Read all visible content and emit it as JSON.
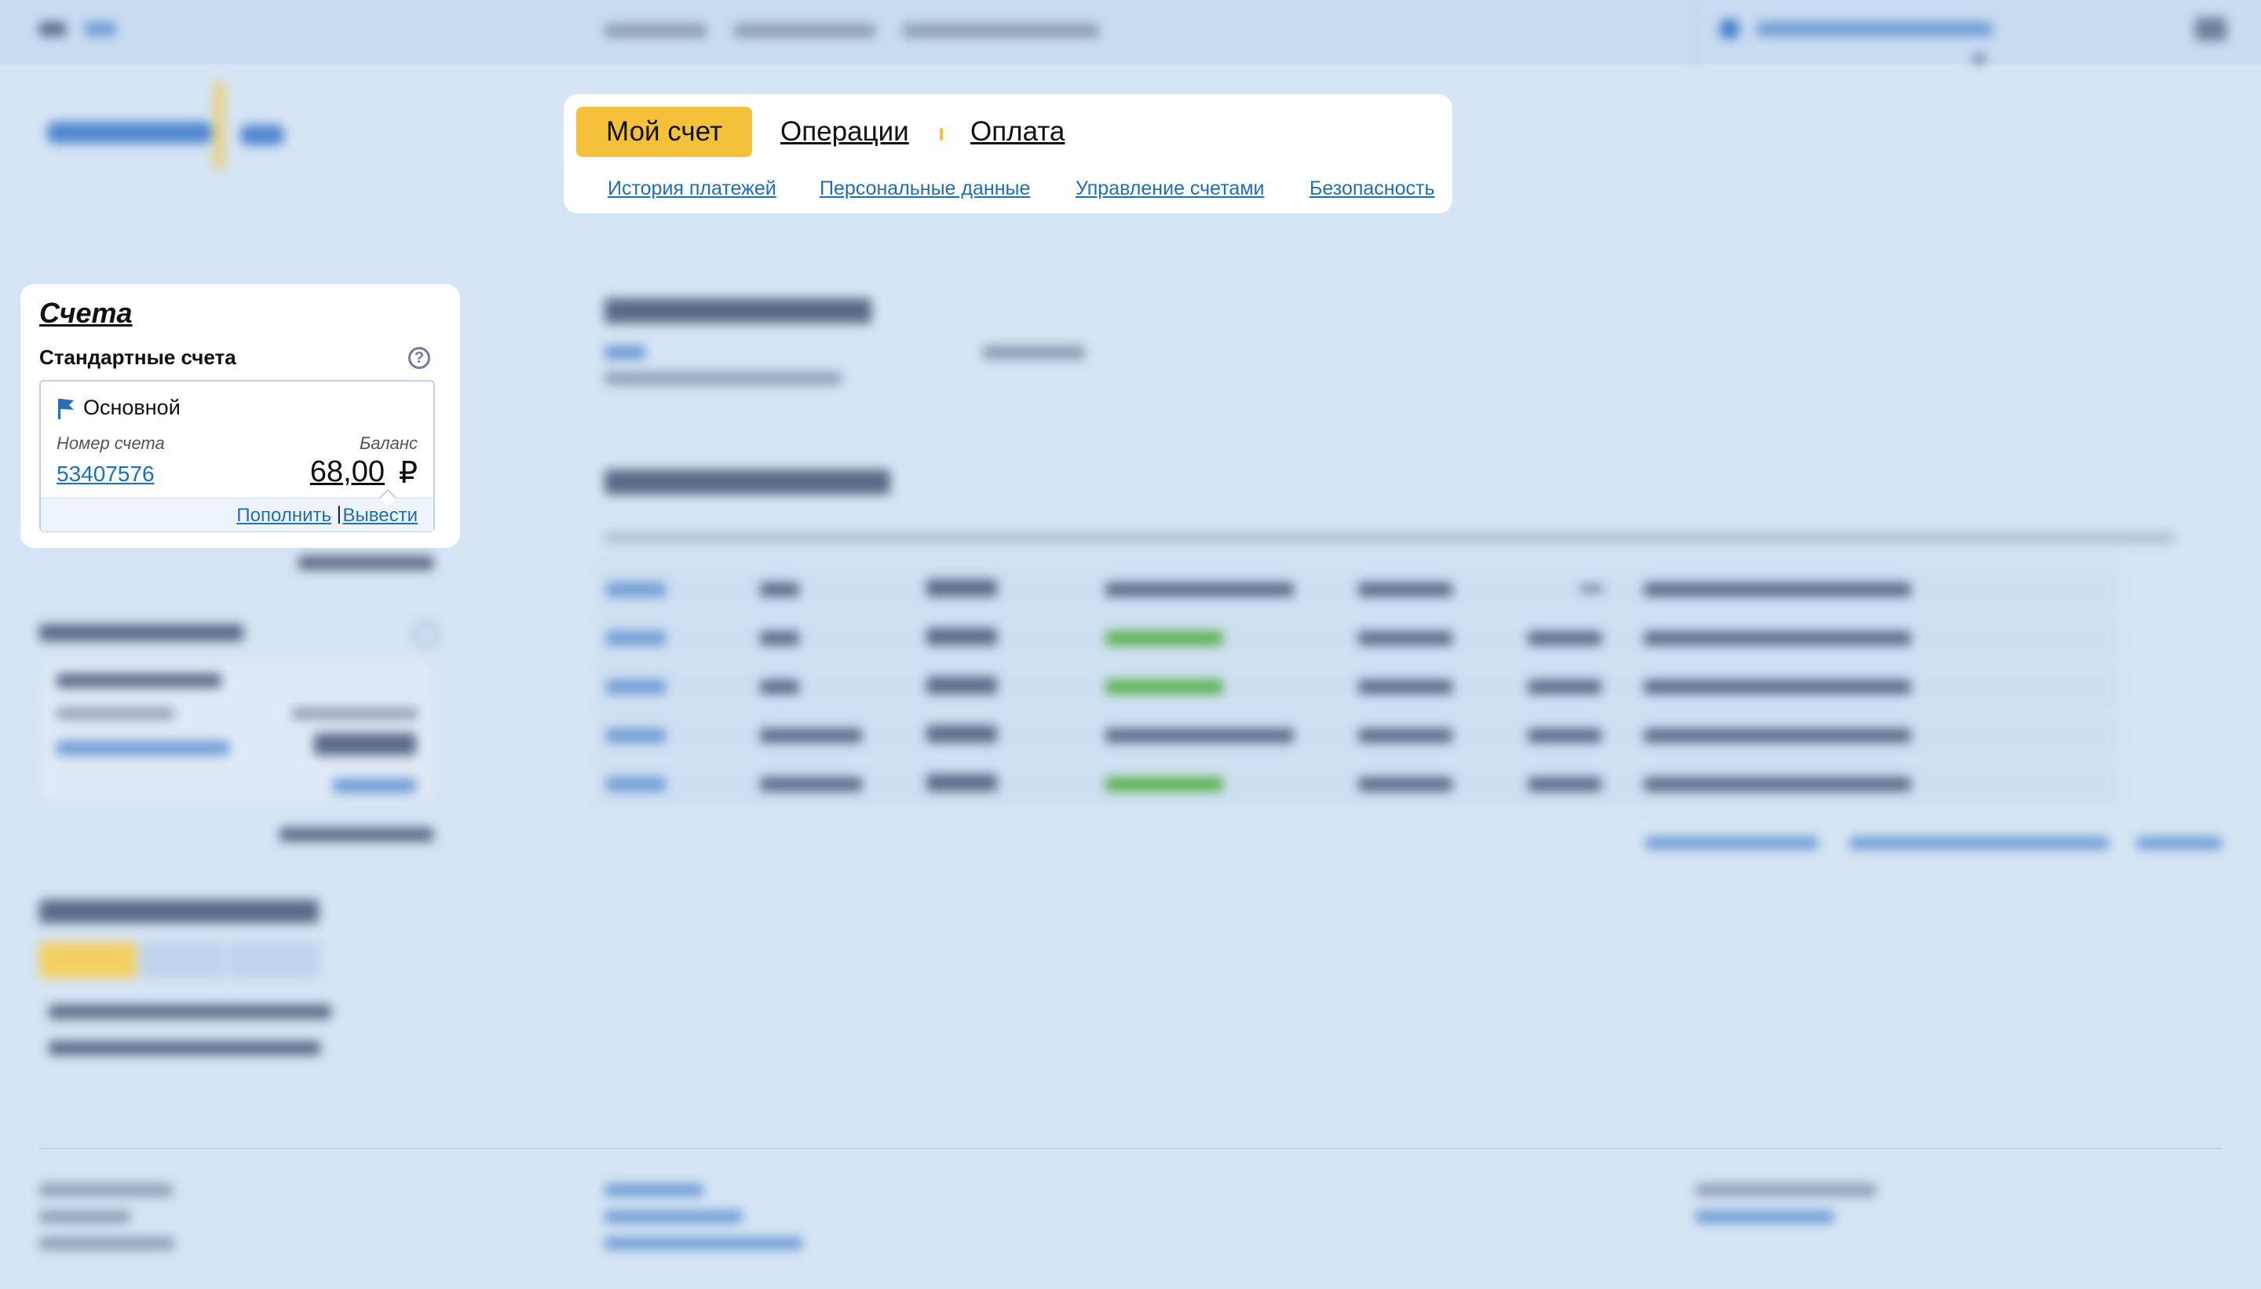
{
  "main_nav": {
    "tabs": [
      {
        "label": "Мой счет",
        "active": true
      },
      {
        "label": "Операции",
        "active": false
      },
      {
        "label": "Оплата",
        "active": false
      }
    ],
    "sub_links": [
      {
        "label": "История платежей"
      },
      {
        "label": "Персональные данные"
      },
      {
        "label": "Управление счетами"
      },
      {
        "label": "Безопасность"
      }
    ]
  },
  "accounts": {
    "title": "Счета",
    "section_label": "Стандартные счета",
    "help_glyph": "?",
    "account": {
      "icon": "flag-icon",
      "name": "Основной",
      "number_label": "Номер счета",
      "number": "53407576",
      "balance_label": "Баланс",
      "balance": "68,00",
      "currency": "₽",
      "deposit_label": "Пополнить",
      "divider": "|",
      "withdraw_label": "Вывести"
    }
  },
  "colors": {
    "page_bg": "#d6e5f5",
    "active_tab": "#f5c03a",
    "link": "#1f6fb5",
    "card": "#ffffff"
  }
}
